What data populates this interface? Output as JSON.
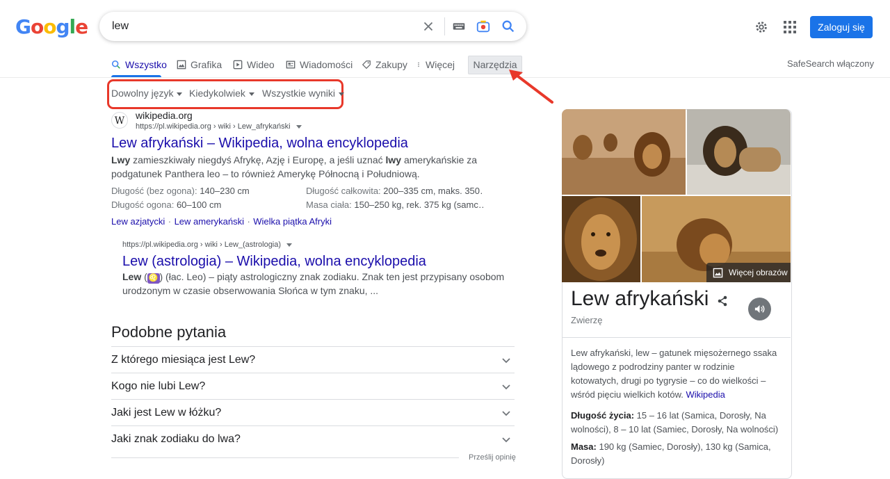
{
  "header": {
    "logo_letters": [
      "G",
      "o",
      "o",
      "g",
      "l",
      "e"
    ],
    "logo_colors": [
      "#4285f4",
      "#ea4335",
      "#fbbc05",
      "#4285f4",
      "#34a853",
      "#ea4335"
    ],
    "search_value": "lew",
    "login_label": "Zaloguj się"
  },
  "tabs": [
    {
      "label": "Wszystko",
      "icon": "search-icon"
    },
    {
      "label": "Grafika",
      "icon": "image-icon"
    },
    {
      "label": "Wideo",
      "icon": "play-icon"
    },
    {
      "label": "Wiadomości",
      "icon": "news-icon"
    },
    {
      "label": "Zakupy",
      "icon": "tag-icon"
    },
    {
      "label": "Więcej",
      "icon": "more-vert-icon"
    }
  ],
  "tools_label": "Narzędzia",
  "safesearch_label": "SafeSearch włączony",
  "filters": [
    "Dowolny język",
    "Kiedykolwiek",
    "Wszystkie wyniki"
  ],
  "result1": {
    "favicon": "W",
    "site": "wikipedia.org",
    "url": "https://pl.wikipedia.org › wiki › Lew_afrykański",
    "title": "Lew afrykański – Wikipedia, wolna encyklopedia",
    "snippet_b1": "Lwy",
    "snippet_t1": " zamieszkiwały niegdyś Afrykę, Azję i Europę, a jeśli uznać ",
    "snippet_b2": "lwy",
    "snippet_t2": " amerykańskie za",
    "snippet_line2": "podgatunek Panthera leo – to również Amerykę Północną i Południową.",
    "facts": [
      {
        "label": "Długość (bez ogona):",
        "value": " 140–230 cm"
      },
      {
        "label": "Długość ogona:",
        "value": " 60–100 cm"
      },
      {
        "label": "Długość całkowita:",
        "value": " 200–335 cm, maks. 350…"
      },
      {
        "label": "Masa ciała:",
        "value": " 150–250 kg, rek. 375 kg (samc…"
      }
    ],
    "sitelinks": [
      "Lew azjatycki",
      "Lew amerykański",
      "Wielka piątka Afryki"
    ]
  },
  "result2": {
    "url": "https://pl.wikipedia.org › wiki › Lew_(astrologia)",
    "title": "Lew (astrologia) – Wikipedia, wolna encyklopedia",
    "snippet_b": "Lew",
    "snippet_sym": "♌",
    "snippet_t1": ") (łac. Leo) – piąty astrologiczny znak zodiaku. Znak ten jest przypisany osobom",
    "snippet_line2": "urodzonym w czasie obserwowania Słońca w tym znaku, ..."
  },
  "paa": {
    "heading": "Podobne pytania",
    "questions": [
      "Z którego miesiąca jest Lew?",
      "Kogo nie lubi Lew?",
      "Jaki jest Lew w łóżku?",
      "Jaki znak zodiaku do lwa?"
    ],
    "feedback": "Prześlij opinię"
  },
  "knowledge_panel": {
    "more_images": "Więcej obrazów",
    "title": "Lew afrykański",
    "subtitle": "Zwierzę",
    "description": "Lew afrykański, lew – gatunek mięsożernego ssaka lądowego z podrodziny panter w rodzinie kotowatych, drugi po tygrysie – co do wielkości – wśród pięciu wielkich kotów.",
    "source": "Wikipedia",
    "facts": [
      {
        "label": "Długość życia:",
        "value": " 15 – 16 lat (Samica, Dorosły, Na wolności), 8 – 10 lat (Samiec, Dorosły, Na wolności)"
      },
      {
        "label": "Masa:",
        "value": " 190 kg (Samiec, Dorosły), 130 kg (Samica, Dorosły)"
      }
    ]
  }
}
